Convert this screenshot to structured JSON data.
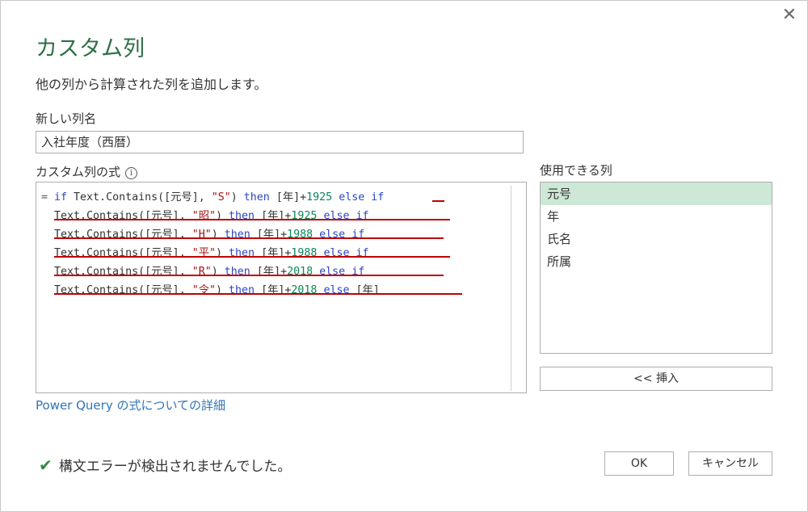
{
  "dialog": {
    "title": "カスタム列",
    "description": "他の列から計算された列を追加します。",
    "close_glyph": "✕"
  },
  "new_column": {
    "label": "新しい列名",
    "value": "入社年度（西暦）"
  },
  "formula": {
    "label": "カスタム列の式",
    "info_glyph": "i",
    "lines": [
      [
        [
          "eq",
          "= "
        ],
        [
          "kw",
          "if"
        ],
        [
          "t",
          " Text.Contains([元号], "
        ],
        [
          "str",
          "\"S\""
        ],
        [
          "t",
          ") "
        ],
        [
          "kw",
          "then"
        ],
        [
          "t",
          " [年]+"
        ],
        [
          "num",
          "1925"
        ],
        [
          "t",
          " "
        ],
        [
          "kw",
          "else"
        ],
        [
          "t",
          " "
        ],
        [
          "kw",
          "if"
        ]
      ],
      [
        [
          "t",
          "  Text.Contains([元号], "
        ],
        [
          "str",
          "\"昭\""
        ],
        [
          "t",
          ") "
        ],
        [
          "kw",
          "then"
        ],
        [
          "t",
          " [年]+"
        ],
        [
          "num",
          "1925"
        ],
        [
          "t",
          " "
        ],
        [
          "kw",
          "else"
        ],
        [
          "t",
          " "
        ],
        [
          "kw",
          "if"
        ]
      ],
      [
        [
          "t",
          "  Text.Contains([元号], "
        ],
        [
          "str",
          "\"H\""
        ],
        [
          "t",
          ") "
        ],
        [
          "kw",
          "then"
        ],
        [
          "t",
          " [年]+"
        ],
        [
          "num",
          "1988"
        ],
        [
          "t",
          " "
        ],
        [
          "kw",
          "else"
        ],
        [
          "t",
          " "
        ],
        [
          "kw",
          "if"
        ]
      ],
      [
        [
          "t",
          "  Text.Contains([元号], "
        ],
        [
          "str",
          "\"平\""
        ],
        [
          "t",
          ") "
        ],
        [
          "kw",
          "then"
        ],
        [
          "t",
          " [年]+"
        ],
        [
          "num",
          "1988"
        ],
        [
          "t",
          " "
        ],
        [
          "kw",
          "else"
        ],
        [
          "t",
          " "
        ],
        [
          "kw",
          "if"
        ]
      ],
      [
        [
          "t",
          "  Text.Contains([元号], "
        ],
        [
          "str",
          "\"R\""
        ],
        [
          "t",
          ") "
        ],
        [
          "kw",
          "then"
        ],
        [
          "t",
          " [年]+"
        ],
        [
          "num",
          "2018"
        ],
        [
          "t",
          " "
        ],
        [
          "kw",
          "else"
        ],
        [
          "t",
          " "
        ],
        [
          "kw",
          "if"
        ]
      ],
      [
        [
          "t",
          "  Text.Contains([元号], "
        ],
        [
          "str",
          "\"令\""
        ],
        [
          "t",
          ") "
        ],
        [
          "kw",
          "then"
        ],
        [
          "t",
          " [年]+"
        ],
        [
          "num",
          "2018"
        ],
        [
          "t",
          " "
        ],
        [
          "kw",
          "else"
        ],
        [
          "t",
          " [年]"
        ]
      ]
    ]
  },
  "available_columns": {
    "label": "使用できる列",
    "items": [
      "元号",
      "年",
      "氏名",
      "所属"
    ],
    "selected": "元号",
    "insert_label": "<< 挿入"
  },
  "help_link": "Power Query の式についての詳細",
  "status": {
    "check_glyph": "✔",
    "text": "構文エラーが検出されませんでした。"
  },
  "buttons": {
    "ok": "OK",
    "cancel": "キャンセル"
  },
  "colors": {
    "title": "#2e6f46",
    "keyword": "#2b48c4",
    "string": "#a31515",
    "number": "#098658",
    "underline": "#c00000",
    "selected_row": "#cde8d6",
    "link": "#2e75b6",
    "check": "#2e8b3e"
  }
}
